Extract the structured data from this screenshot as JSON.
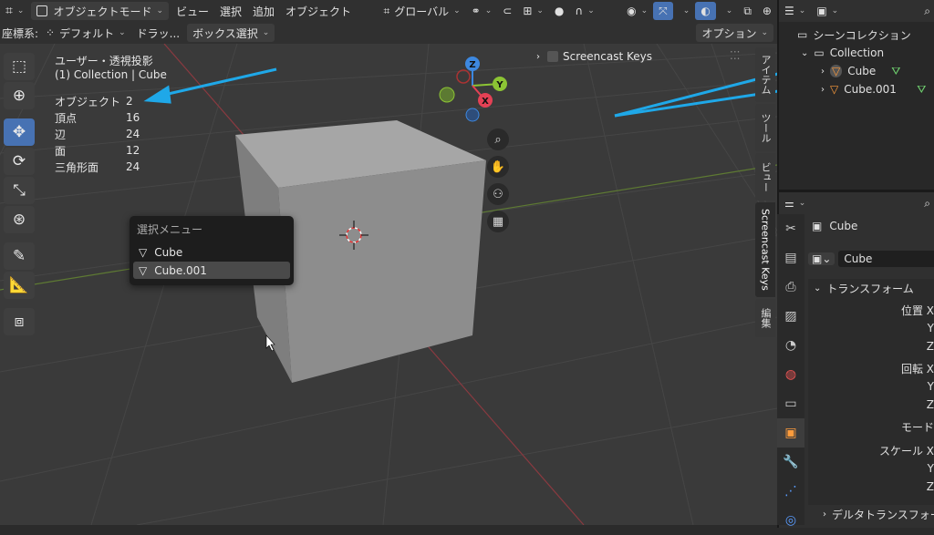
{
  "header": {
    "mode_label": "オブジェクトモード",
    "menu": [
      "ビュー",
      "選択",
      "追加",
      "オブジェクト"
    ],
    "orientation": "グローバル",
    "coord_label": "座標系:",
    "coord_value": "デフォルト",
    "drag_label": "ドラッ...",
    "box_select": "ボックス選択",
    "options": "オプション"
  },
  "viewport": {
    "view_name": "ユーザー・透視投影",
    "collection_info": "(1) Collection | Cube",
    "stats": [
      {
        "label": "オブジェクト",
        "value": "2"
      },
      {
        "label": "頂点",
        "value": "16"
      },
      {
        "label": "辺",
        "value": "24"
      },
      {
        "label": "面",
        "value": "12"
      },
      {
        "label": "三角形面",
        "value": "24"
      }
    ],
    "gizmo": {
      "x": "X",
      "y": "Y",
      "z": "Z"
    },
    "screencast_keys": "Screencast Keys"
  },
  "selection_menu": {
    "title": "選択メニュー",
    "items": [
      "Cube",
      "Cube.001"
    ]
  },
  "side_tabs": [
    "アイテム",
    "ツール",
    "ビュー",
    "Screencast Keys",
    "編集"
  ],
  "outliner": {
    "scene_collection": "シーンコレクション",
    "collection": "Collection",
    "objects": [
      "Cube",
      "Cube.001"
    ]
  },
  "properties": {
    "object_name": "Cube",
    "field_name": "Cube",
    "section": "トランスフォーム",
    "rows": [
      "位置 X",
      "Y",
      "Z",
      "回転 X",
      "Y",
      "Z",
      "モード",
      "スケール X",
      "Y",
      "Z"
    ],
    "delta": "デルタトランスフォーム"
  },
  "colors": {
    "accent": "#4772b3",
    "arrow": "#1fa8e8",
    "axis_x": "#e44155",
    "axis_y": "#8cc434",
    "axis_z": "#3d88e0",
    "object_orange": "#ff9c3c"
  }
}
